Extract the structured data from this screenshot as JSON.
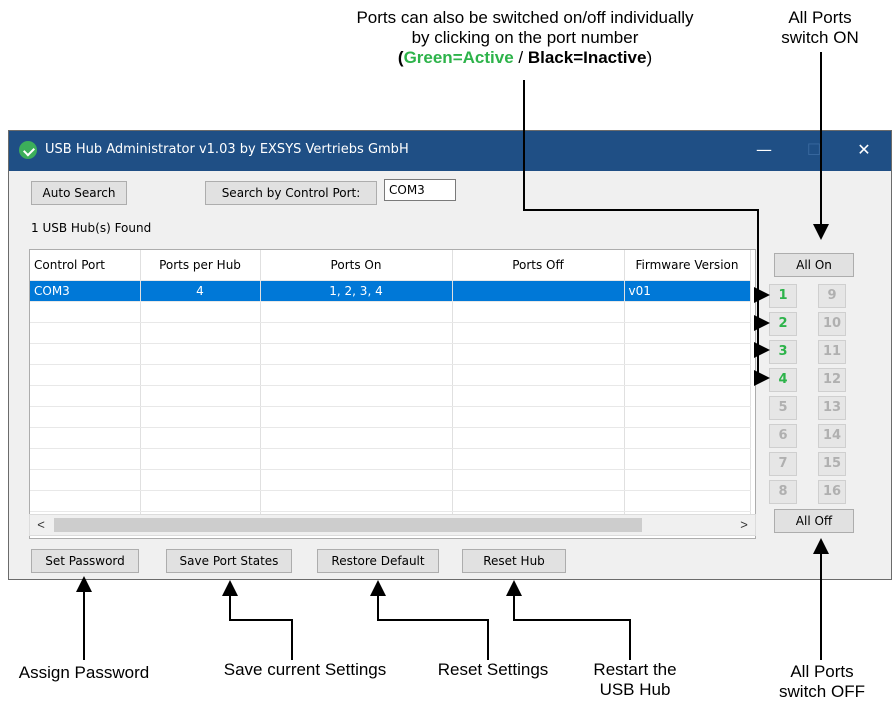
{
  "annotations": {
    "top_line1": "Ports can also be switched on/off individually",
    "top_line2": "by clicking on the port number",
    "paren_open": "(",
    "green_label": "Green=Active",
    "slash": " / ",
    "black_label": "Black=Inactive",
    "paren_close": ")",
    "all_on_line1": "All Ports",
    "all_on_line2": "switch ON",
    "all_off_line1": "All Ports",
    "all_off_line2": "switch OFF",
    "assign_password": "Assign Password",
    "save_settings": "Save current Settings",
    "reset_settings": "Reset Settings",
    "restart_line1": "Restart the",
    "restart_line2": "USB Hub"
  },
  "window": {
    "title": "USB Hub Administrator v1.03 by EXSYS Vertriebs GmbH",
    "minimize": "—",
    "maximize": "☐",
    "close": "✕"
  },
  "toolbar": {
    "auto_search": "Auto Search",
    "search_by_port": "Search by Control Port:",
    "port_value": "COM3",
    "found_text": "1 USB Hub(s) Found"
  },
  "table": {
    "headers": [
      "Control Port",
      "Ports per Hub",
      "Ports On",
      "Ports Off",
      "Firmware Version"
    ],
    "rows": [
      {
        "control_port": "COM3",
        "ports_per_hub": "4",
        "ports_on": "1, 2, 3, 4",
        "ports_off": "",
        "firmware": "v01"
      }
    ],
    "scroll_left": "<",
    "scroll_right": ">"
  },
  "ports": {
    "all_on": "All On",
    "all_off": "All Off",
    "left": [
      {
        "label": "1",
        "active": true
      },
      {
        "label": "2",
        "active": true
      },
      {
        "label": "3",
        "active": true
      },
      {
        "label": "4",
        "active": true
      },
      {
        "label": "5",
        "active": false
      },
      {
        "label": "6",
        "active": false
      },
      {
        "label": "7",
        "active": false
      },
      {
        "label": "8",
        "active": false
      }
    ],
    "right": [
      {
        "label": "9",
        "active": false
      },
      {
        "label": "10",
        "active": false
      },
      {
        "label": "11",
        "active": false
      },
      {
        "label": "12",
        "active": false
      },
      {
        "label": "13",
        "active": false
      },
      {
        "label": "14",
        "active": false
      },
      {
        "label": "15",
        "active": false
      },
      {
        "label": "16",
        "active": false
      }
    ]
  },
  "bottom_buttons": {
    "set_password": "Set Password",
    "save_port_states": "Save Port States",
    "restore_default": "Restore Default",
    "reset_hub": "Reset Hub"
  },
  "colors": {
    "titlebar": "#1f4f85",
    "selection": "#0078d7",
    "active_port": "#2db34a"
  }
}
